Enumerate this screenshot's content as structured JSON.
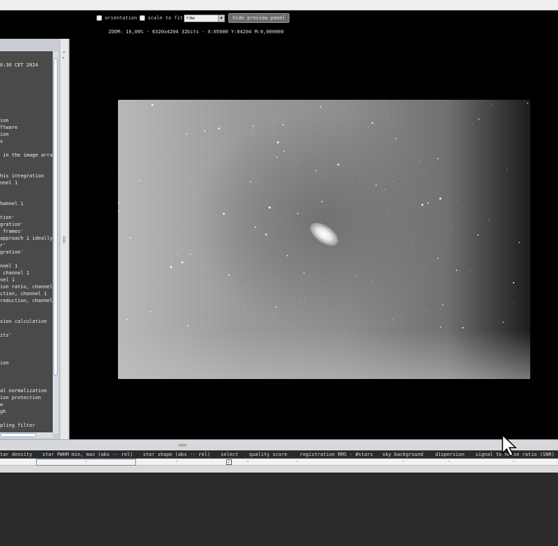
{
  "toolbar": {
    "orientation_label": "orientation",
    "scale_to_fit_label": "scale to fit",
    "stretch_value": "raw",
    "hide_preview_label": "hide preview panel",
    "zoom_status": "ZOOM: 16,00% - 6320x4204 32bits - X:05000 Y:04204 M:0,000000"
  },
  "log": {
    "lines": [
      "6:36 CET 2024",
      "ion",
      "ftware",
      "ion",
      "s",
      " in the image array",
      "his integration",
      "nnel 1",
      "hannel 1",
      "tion'",
      "gration'",
      " frames'",
      "approach 1 ideally'",
      "r'",
      "gration'",
      "nnel 1",
      " channel 1",
      "nel 1",
      "ion ratio, channel",
      "ction, channel 1",
      "reduction, channel",
      "sion calculation",
      "its'",
      "ion",
      "al normalization",
      "ion protection",
      "w",
      "gh",
      "pling filter"
    ]
  },
  "table": {
    "headers": [
      "tar density",
      "star FWHM min, max (abs -- rel)",
      "star shape (abs -- rel)",
      "select",
      "quality score",
      "registration RMS - #stars",
      "sky background",
      "dispersion",
      "signal to noise ratio (SNR)"
    ],
    "row": {
      "star_fwhm": "-",
      "star_shape": "-",
      "select_mark": "✓",
      "quality": "-",
      "registration": "-",
      "sky_background": "-",
      "dispersion": "-",
      "snr": "-"
    }
  },
  "colors": {
    "panel_bg": "#000000",
    "log_bg": "#4a4a4a",
    "scroll_accent": "#7ea6d8"
  }
}
